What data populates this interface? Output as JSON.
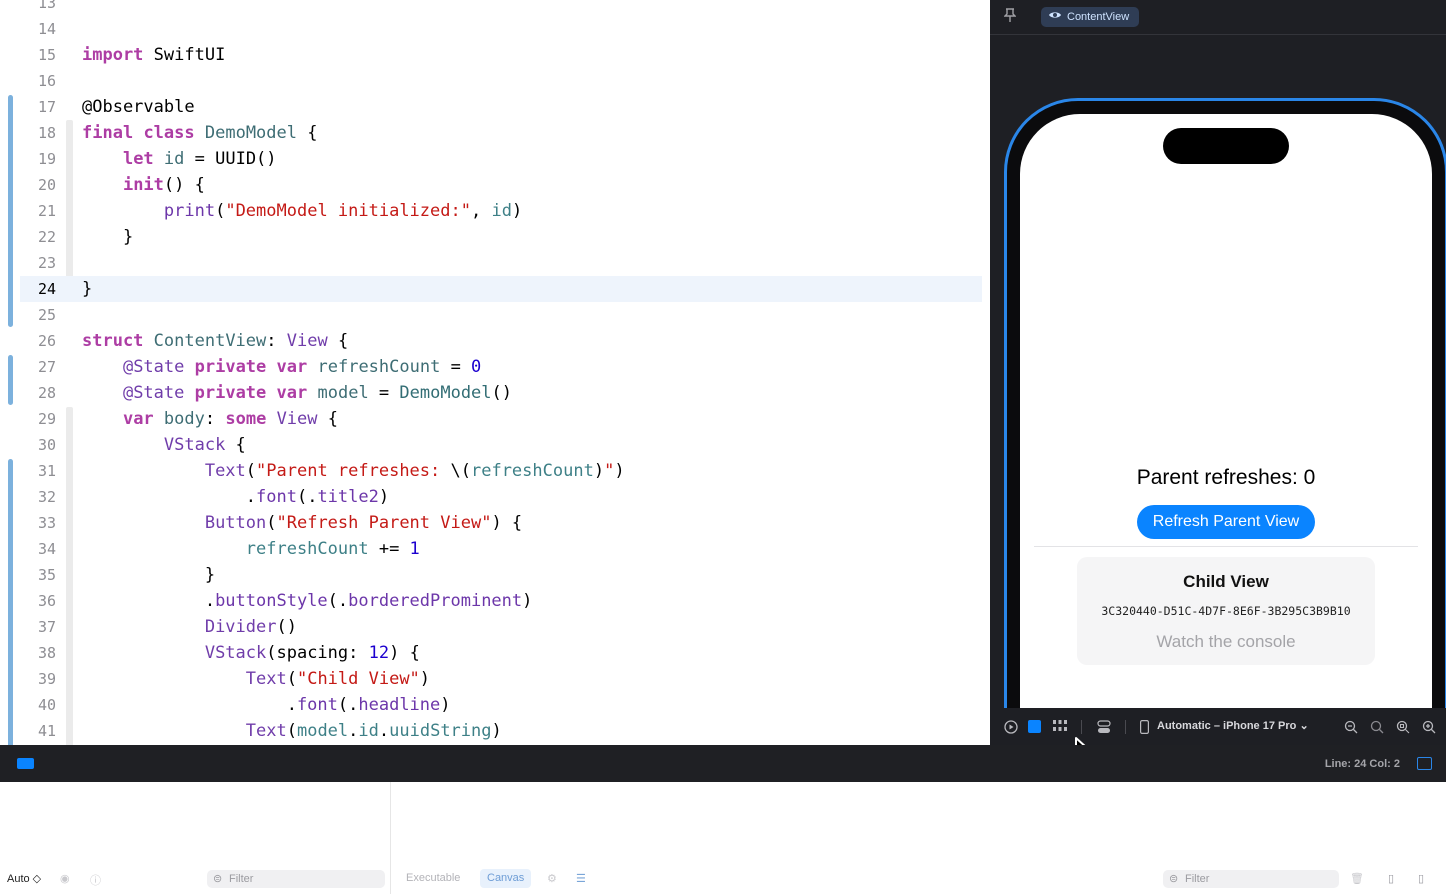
{
  "editor": {
    "current_line": "24",
    "lines": [
      {
        "n": "13",
        "text": ""
      },
      {
        "n": "14",
        "text": ""
      },
      {
        "n": "15",
        "text": "import SwiftUI"
      },
      {
        "n": "16",
        "text": ""
      },
      {
        "n": "17",
        "text": "@Observable"
      },
      {
        "n": "18",
        "text": "final class DemoModel {"
      },
      {
        "n": "19",
        "text": "    let id = UUID()"
      },
      {
        "n": "20",
        "text": "    init() {"
      },
      {
        "n": "21",
        "text": "        print(\"DemoModel initialized:\", id)"
      },
      {
        "n": "22",
        "text": "    }"
      },
      {
        "n": "23",
        "text": ""
      },
      {
        "n": "24",
        "text": "}"
      },
      {
        "n": "25",
        "text": ""
      },
      {
        "n": "26",
        "text": "struct ContentView: View {"
      },
      {
        "n": "27",
        "text": "    @State private var refreshCount = 0"
      },
      {
        "n": "28",
        "text": "    @State private var model = DemoModel()"
      },
      {
        "n": "29",
        "text": "    var body: some View {"
      },
      {
        "n": "30",
        "text": "        VStack {"
      },
      {
        "n": "31",
        "text": "            Text(\"Parent refreshes: \\(refreshCount)\")"
      },
      {
        "n": "32",
        "text": "                .font(.title2)"
      },
      {
        "n": "33",
        "text": "            Button(\"Refresh Parent View\") {"
      },
      {
        "n": "34",
        "text": "                refreshCount += 1"
      },
      {
        "n": "35",
        "text": "            }"
      },
      {
        "n": "36",
        "text": "            .buttonStyle(.borderedProminent)"
      },
      {
        "n": "37",
        "text": "            Divider()"
      },
      {
        "n": "38",
        "text": "            VStack(spacing: 12) {"
      },
      {
        "n": "39",
        "text": "                Text(\"Child View\")"
      },
      {
        "n": "40",
        "text": "                    .font(.headline)"
      },
      {
        "n": "41",
        "text": "                Text(model.id.uuidString)"
      }
    ]
  },
  "canvas": {
    "tab_label": "ContentView",
    "device_label": "Automatic – iPhone 17 Pro",
    "preview": {
      "parent_text": "Parent refreshes: 0",
      "refresh_button": "Refresh Parent View",
      "child_title": "Child View",
      "child_uuid": "3C320440-D51C-4D7F-8E6F-3B295C3B9B10",
      "child_caption": "Watch the console"
    }
  },
  "statusbar": {
    "position": "Line: 24  Col: 2"
  },
  "debug": {
    "auto_label": "Auto ◇",
    "filter_left": "Filter",
    "tab_executable": "Executable",
    "tab_canvas": "Canvas",
    "filter_right": "Filter"
  },
  "colors": {
    "accent": "#0a84ff",
    "keyword": "#ad3da4",
    "string": "#c41a16",
    "number": "#1c00cf"
  }
}
